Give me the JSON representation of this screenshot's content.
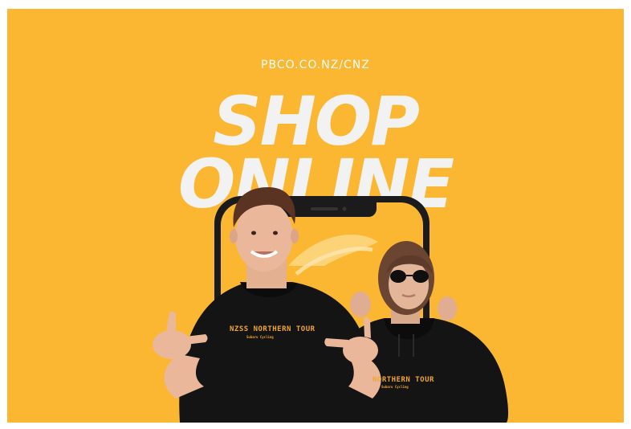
{
  "poster": {
    "url": "PBCO.CO.NZ/CNZ",
    "headline_line1": "SHOP",
    "headline_line2": "ONLINE",
    "shirt1_print": "NZSS NORTHERN TOUR",
    "shirt1_sub": "Subaru Cycling",
    "shirt2_print": "NORTHERN TOUR",
    "shirt2_sub": "Subaru Cycling",
    "colors": {
      "background": "#fbb731",
      "headline": "#f2f2f2",
      "shirt": "#141414",
      "print": "#f0a531"
    }
  }
}
